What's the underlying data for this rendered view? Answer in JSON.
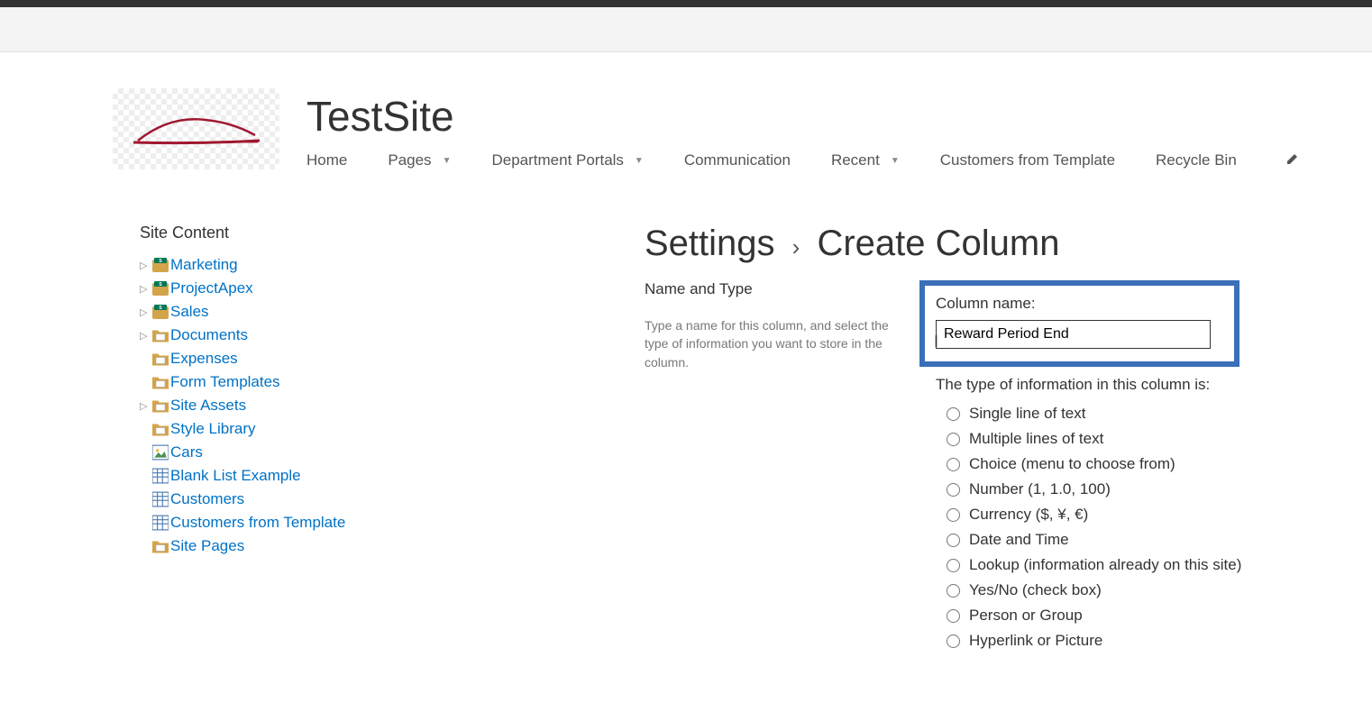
{
  "site": {
    "title": "TestSite"
  },
  "nav": {
    "items": [
      {
        "label": "Home",
        "hasDropdown": false
      },
      {
        "label": "Pages",
        "hasDropdown": true
      },
      {
        "label": "Department Portals",
        "hasDropdown": true
      },
      {
        "label": "Communication",
        "hasDropdown": false
      },
      {
        "label": "Recent",
        "hasDropdown": true
      },
      {
        "label": "Customers from Template",
        "hasDropdown": false
      },
      {
        "label": "Recycle Bin",
        "hasDropdown": false
      }
    ]
  },
  "sidebar": {
    "title": "Site Content",
    "items": [
      {
        "label": "Marketing",
        "icon": "site",
        "expandable": true,
        "indent": 0
      },
      {
        "label": "ProjectApex",
        "icon": "site",
        "expandable": true,
        "indent": 0
      },
      {
        "label": "Sales",
        "icon": "site",
        "expandable": true,
        "indent": 0
      },
      {
        "label": "Documents",
        "icon": "folder",
        "expandable": true,
        "indent": 0
      },
      {
        "label": "Expenses",
        "icon": "folder",
        "expandable": false,
        "indent": 1
      },
      {
        "label": "Form Templates",
        "icon": "folder",
        "expandable": false,
        "indent": 1
      },
      {
        "label": "Site Assets",
        "icon": "folder",
        "expandable": true,
        "indent": 0
      },
      {
        "label": "Style Library",
        "icon": "folder",
        "expandable": false,
        "indent": 1
      },
      {
        "label": "Cars",
        "icon": "picture",
        "expandable": false,
        "indent": 1
      },
      {
        "label": "Blank List Example",
        "icon": "list",
        "expandable": false,
        "indent": 1
      },
      {
        "label": "Customers",
        "icon": "list",
        "expandable": false,
        "indent": 1
      },
      {
        "label": "Customers from Template",
        "icon": "list",
        "expandable": false,
        "indent": 1
      },
      {
        "label": "Site Pages",
        "icon": "folder",
        "expandable": false,
        "indent": 1
      }
    ]
  },
  "breadcrumb": {
    "parent": "Settings",
    "current": "Create Column"
  },
  "form": {
    "section_title": "Name and Type",
    "section_desc": "Type a name for this column, and select the type of information you want to store in the column.",
    "column_name_label": "Column name:",
    "column_name_value": "Reward Period End",
    "type_label": "The type of information in this column is:",
    "type_options": [
      "Single line of text",
      "Multiple lines of text",
      "Choice (menu to choose from)",
      "Number (1, 1.0, 100)",
      "Currency ($, ¥, €)",
      "Date and Time",
      "Lookup (information already on this site)",
      "Yes/No (check box)",
      "Person or Group",
      "Hyperlink or Picture"
    ]
  }
}
